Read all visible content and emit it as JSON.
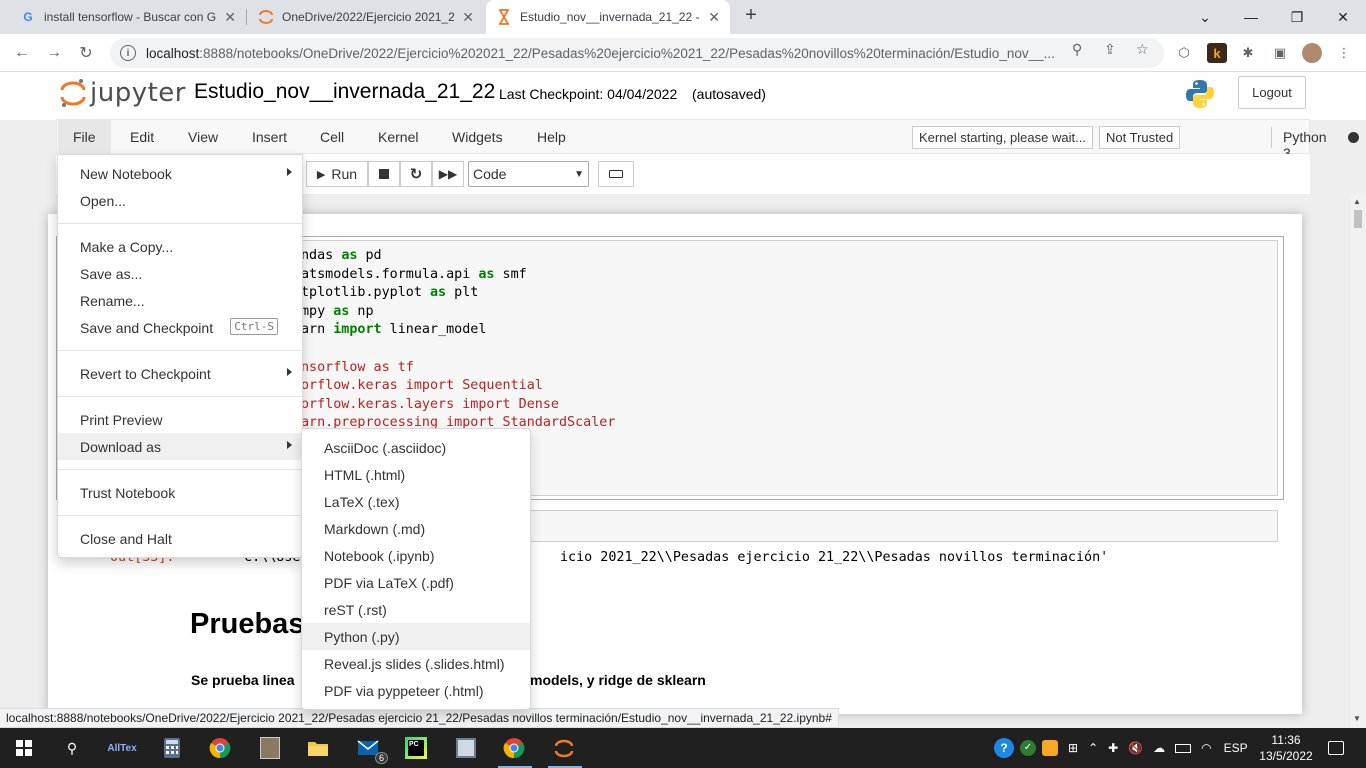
{
  "browser": {
    "tabs": [
      {
        "title": "install tensorflow - Buscar con Go",
        "icon": "google-icon"
      },
      {
        "title": "OneDrive/2022/Ejercicio 2021_22/",
        "icon": "jupyter-icon"
      },
      {
        "title": "Estudio_nov__invernada_21_22 -",
        "icon": "hourglass-icon"
      }
    ],
    "url_host": "localhost",
    "url_path": ":8888/notebooks/OneDrive/2022/Ejercicio%202021_22/Pesadas%20ejercicio%2021_22/Pesadas%20novillos%20terminación/Estudio_nov__...",
    "status_link": "localhost:8888/notebooks/OneDrive/2022/Ejercicio 2021_22/Pesadas ejercicio 21_22/Pesadas novillos terminación/Estudio_nov__invernada_21_22.ipynb#"
  },
  "jupyter": {
    "logo_text": "jupyter",
    "notebook_name": "Estudio_nov__invernada_21_22",
    "checkpoint": "Last Checkpoint: 04/04/2022",
    "autosave": "(autosaved)",
    "logout": "Logout",
    "kernel_status": "Kernel starting, please wait...",
    "trust_status": "Not Trusted",
    "kernel_name": "Python 3"
  },
  "menubar": [
    "File",
    "Edit",
    "View",
    "Insert",
    "Cell",
    "Kernel",
    "Widgets",
    "Help"
  ],
  "toolbar": {
    "run_label": "Run",
    "cell_type": "Code"
  },
  "file_menu": {
    "groups": [
      [
        {
          "label": "New Notebook",
          "submenu": true
        },
        {
          "label": "Open..."
        }
      ],
      [
        {
          "label": "Make a Copy..."
        },
        {
          "label": "Save as..."
        },
        {
          "label": "Rename..."
        },
        {
          "label": "Save and Checkpoint",
          "shortcut": "Ctrl-S"
        }
      ],
      [
        {
          "label": "Revert to Checkpoint",
          "submenu": true
        }
      ],
      [
        {
          "label": "Print Preview"
        },
        {
          "label": "Download as",
          "submenu": true,
          "highlighted": true
        }
      ],
      [
        {
          "label": "Trust Notebook"
        }
      ],
      [
        {
          "label": "Close and Halt"
        }
      ]
    ]
  },
  "download_menu": [
    {
      "label": "AsciiDoc (.asciidoc)"
    },
    {
      "label": "HTML (.html)"
    },
    {
      "label": "LaTeX (.tex)"
    },
    {
      "label": "Markdown (.md)"
    },
    {
      "label": "Notebook (.ipynb)"
    },
    {
      "label": "PDF via LaTeX (.pdf)"
    },
    {
      "label": "reST (.rst)"
    },
    {
      "label": "Python (.py)",
      "highlighted": true
    },
    {
      "label": "Reveal.js slides (.slides.html)"
    },
    {
      "label": "PDF via pyppeteer (.html)"
    }
  ],
  "code_lines": [
    [
      {
        "t": "ndas "
      },
      {
        "t": "as",
        "k": "kw"
      },
      {
        "t": " pd"
      }
    ],
    [
      {
        "t": "atsmodels.formula.api "
      },
      {
        "t": "as",
        "k": "kw"
      },
      {
        "t": " smf"
      }
    ],
    [
      {
        "t": "tplotlib.pyplot "
      },
      {
        "t": "as",
        "k": "kw"
      },
      {
        "t": " plt"
      }
    ],
    [
      {
        "t": "mpy "
      },
      {
        "t": "as",
        "k": "kw"
      },
      {
        "t": " np"
      }
    ],
    [
      {
        "t": "arn "
      },
      {
        "t": "import",
        "k": "kw"
      },
      {
        "t": " linear_model"
      }
    ],
    [
      {
        "t": ""
      }
    ],
    [
      {
        "t": "nsorflow as tf",
        "k": "cm"
      }
    ],
    [
      {
        "t": "orflow.keras import Sequential",
        "k": "cm"
      }
    ],
    [
      {
        "t": "orflow.keras.layers import Dense",
        "k": "cm"
      }
    ],
    [
      {
        "t": "arn.preprocessing import StandardScaler",
        "k": "cm"
      }
    ]
  ],
  "output": {
    "prompt": "Out[33]:",
    "left": "'C:\\\\Users\\\\Pa",
    "right": "icio 2021_22\\\\Pesadas ejercicio 21_22\\\\Pesadas novillos terminación'"
  },
  "markdown": {
    "heading": "Pruebas",
    "para_left": "Se prueba linea",
    "para_right": "models, y ridge de sklearn"
  },
  "taskbar": {
    "lang": "ESP",
    "time": "11:36",
    "date": "13/5/2022",
    "mail_badge": "6"
  }
}
